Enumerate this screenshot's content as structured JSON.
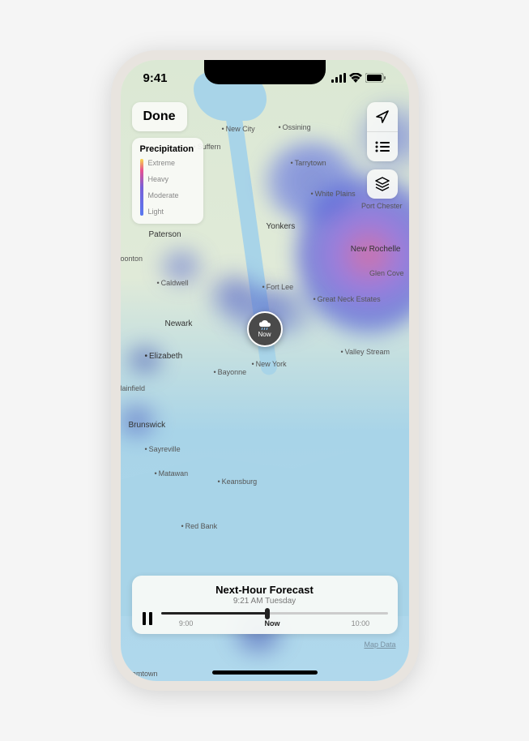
{
  "status": {
    "time": "9:41"
  },
  "controls": {
    "done": "Done"
  },
  "legend": {
    "title": "Precipitation",
    "levels": [
      "Extreme",
      "Heavy",
      "Moderate",
      "Light"
    ]
  },
  "pin": {
    "label": "Now"
  },
  "places": {
    "new_city": "New City",
    "ossining": "Ossining",
    "suffern": "Suffern",
    "tarrytown": "Tarrytown",
    "white_plains": "White Plains",
    "port_chester": "Port Chester",
    "yonkers": "Yonkers",
    "new_rochelle": "New Rochelle",
    "paterson": "Paterson",
    "glen_cove": "Glen Cove",
    "fort_lee": "Fort Lee",
    "great_neck": "Great Neck Estates",
    "caldwell": "Caldwell",
    "oonton": "oonton",
    "newark": "Newark",
    "new_york": "New York",
    "valley_stream": "Valley Stream",
    "elizabeth": "Elizabeth",
    "bayonne": "Bayonne",
    "plainfield": "lainfield",
    "brunswick": "Brunswick",
    "sayreville": "Sayreville",
    "matawan": "Matawan",
    "keansburg": "Keansburg",
    "red_bank": "Red Bank",
    "ramtown": "Ramtown"
  },
  "timeline": {
    "title": "Next-Hour Forecast",
    "subtitle": "9:21 AM Tuesday",
    "ticks": {
      "start": "9:00",
      "now": "Now",
      "end": "10:00"
    }
  },
  "attribution": "Map Data"
}
